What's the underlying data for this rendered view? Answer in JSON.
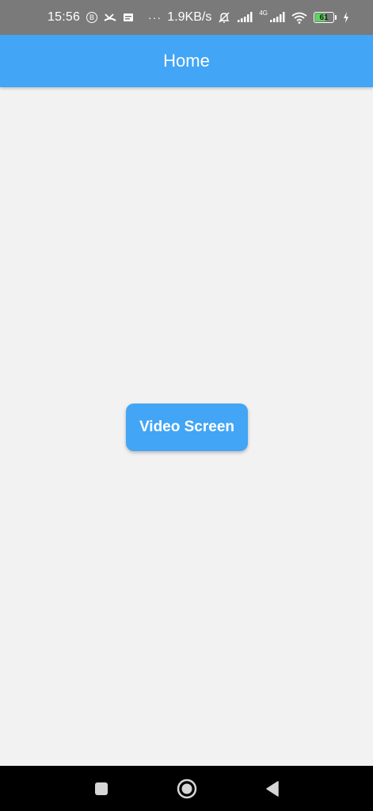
{
  "status_bar": {
    "time": "15:56",
    "badge": "B",
    "more": "···",
    "net_speed": "1.9KB/s",
    "network_type": "4G",
    "battery_level": "61",
    "battery_fraction": 0.61,
    "icons": [
      "b-badge",
      "call-missed-icon",
      "message-icon",
      "more-icon",
      "mute-bell-icon",
      "signal-icon",
      "signal-4g-icon",
      "wifi-icon",
      "battery-icon",
      "charging-icon"
    ]
  },
  "app_bar": {
    "title": "Home",
    "color": "#42a5f5"
  },
  "main": {
    "button_label": "Video Screen",
    "button_color": "#42a5f5",
    "background": "#f2f2f2"
  },
  "nav_bar": {
    "icons": [
      "recents-square-icon",
      "home-circle-icon",
      "back-triangle-icon"
    ]
  }
}
